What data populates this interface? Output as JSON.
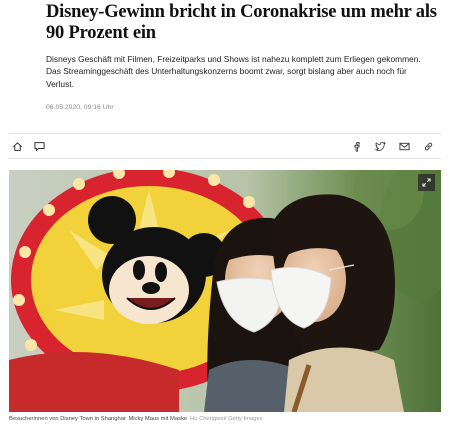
{
  "article": {
    "headline": "Disney-Gewinn bricht in Coronakrise um mehr als 90 Prozent ein",
    "lead": "Disneys Geschäft mit Filmen, Freizeitparks und Shows ist nahezu komplett zum Erliegen gekommen. Das Streaminggeschäft des Unterhaltungskonzerns boomt zwar, sorgt bislang aber auch noch für Verlust.",
    "timestamp": "06.05.2020, 09:16 Uhr"
  },
  "toolbar": {
    "left_icons": [
      "home-icon",
      "comment-icon"
    ],
    "right_icons": [
      "facebook-icon",
      "twitter-icon",
      "mail-icon",
      "link-icon"
    ]
  },
  "photo": {
    "caption": "Besucherinnen von Disney Town in Shanghai: Micky Maus mit Maske",
    "credit": "Hu Chengwei/ Getty Images"
  },
  "colors": {
    "headline": "#111111",
    "timestamp": "#8a8a8a",
    "divider": "#e3e3e3",
    "sign_red": "#d8242e",
    "sign_yellow": "#f2d23a"
  }
}
